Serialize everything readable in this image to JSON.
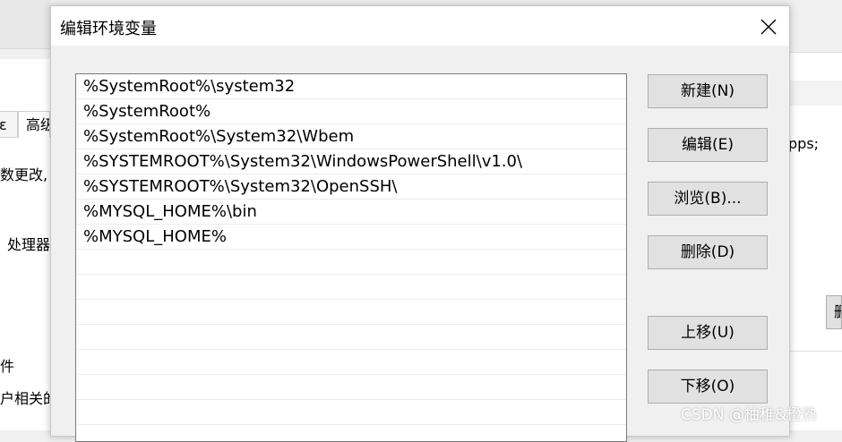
{
  "background": {
    "tab_left": "ɛ",
    "tab_advanced": "高级",
    "text_param_changes": "数更改,",
    "text_processor": "处理器",
    "text_file": "件",
    "text_related": "户相关的",
    "right_text": "pps;",
    "right_button": "删"
  },
  "dialog": {
    "title": "编辑环境变量",
    "entries": [
      "%SystemRoot%\\system32",
      "%SystemRoot%",
      "%SystemRoot%\\System32\\Wbem",
      "%SYSTEMROOT%\\System32\\WindowsPowerShell\\v1.0\\",
      "%SYSTEMROOT%\\System32\\OpenSSH\\",
      "%MYSQL_HOME%\\bin",
      "%MYSQL_HOME%",
      "",
      "",
      "",
      "",
      "",
      "",
      ""
    ],
    "buttons": {
      "new": "新建(N)",
      "edit": "编辑(E)",
      "browse": "浏览(B)...",
      "delete": "删除(D)",
      "move_up": "上移(U)",
      "move_down": "下移(O)"
    }
  },
  "watermark": "CSDN @柚稚&橙熟",
  "colors": {
    "list_border": "#7a7a7a",
    "button_face": "#e1e1e1",
    "button_border": "#adadad"
  }
}
